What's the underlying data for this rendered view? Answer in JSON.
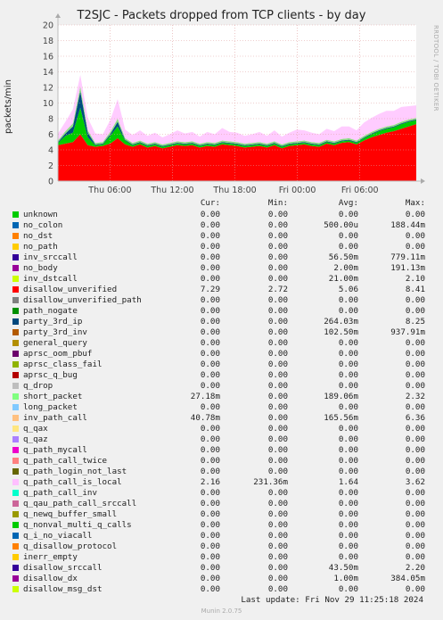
{
  "header": {
    "title": "T2SJC - Packets dropped from TCP clients - by day",
    "ylabel": "packets/min",
    "side_text": "RRDTOOL / TOBI OETIKER"
  },
  "chart_data": {
    "type": "area",
    "title": "T2SJC - Packets dropped from TCP clients - by day",
    "xlabel": "",
    "ylabel": "packets/min",
    "ylim": [
      0,
      20
    ],
    "yticks": [
      0,
      2,
      4,
      6,
      8,
      10,
      12,
      14,
      16,
      18,
      20
    ],
    "xticks": [
      "Thu 06:00",
      "Thu 12:00",
      "Thu 18:00",
      "Fri 00:00",
      "Fri 06:00"
    ],
    "x_range_hours": [
      "Thu 01:00",
      "Fri 11:25"
    ],
    "grid": true,
    "series": [
      {
        "name": "disallow_unverified",
        "color": "#ff0000",
        "values": [
          4.6,
          4.8,
          5.0,
          6.0,
          4.6,
          4.4,
          4.5,
          4.8,
          5.5,
          4.7,
          4.4,
          4.7,
          4.3,
          4.5,
          4.2,
          4.4,
          4.6,
          4.5,
          4.6,
          4.3,
          4.5,
          4.4,
          4.7,
          4.6,
          4.5,
          4.3,
          4.4,
          4.5,
          4.3,
          4.6,
          4.2,
          4.5,
          4.6,
          4.7,
          4.5,
          4.4,
          4.8,
          4.6,
          4.9,
          5.0,
          4.7,
          5.2,
          5.6,
          5.9,
          6.2,
          6.4,
          6.7,
          7.0,
          7.3
        ]
      },
      {
        "name": "q_path_call_is_local",
        "color": "#00cc00",
        "values": [
          0.3,
          1.0,
          1.2,
          3.4,
          1.0,
          0.2,
          0.2,
          1.0,
          1.5,
          0.5,
          0.2,
          0.2,
          0.2,
          0.2,
          0.2,
          0.2,
          0.2,
          0.2,
          0.2,
          0.2,
          0.2,
          0.2,
          0.2,
          0.2,
          0.2,
          0.2,
          0.2,
          0.2,
          0.2,
          0.2,
          0.2,
          0.2,
          0.2,
          0.2,
          0.2,
          0.2,
          0.2,
          0.2,
          0.2,
          0.2,
          0.2,
          0.3,
          0.4,
          0.5,
          0.5,
          0.5,
          0.6,
          0.6,
          0.5
        ]
      },
      {
        "name": "party_3rd_ip",
        "color": "#004d80",
        "values": [
          0.1,
          0.3,
          0.8,
          2.1,
          0.6,
          0.1,
          0.1,
          0.2,
          0.6,
          0.1,
          0.1,
          0.1,
          0.1,
          0.1,
          0.1,
          0.1,
          0.1,
          0.1,
          0.1,
          0.1,
          0.1,
          0.1,
          0.1,
          0.1,
          0.1,
          0.1,
          0.1,
          0.1,
          0.1,
          0.1,
          0.1,
          0.1,
          0.1,
          0.1,
          0.1,
          0.1,
          0.1,
          0.1,
          0.1,
          0.1,
          0.1,
          0.1,
          0.1,
          0.1,
          0.1,
          0.1,
          0.1,
          0.1,
          0.1
        ]
      },
      {
        "name": "short_packet",
        "color": "#8fde84",
        "values": [
          0.2,
          0.3,
          0.4,
          0.6,
          0.3,
          0.2,
          0.2,
          0.3,
          0.4,
          0.2,
          0.2,
          0.2,
          0.2,
          0.2,
          0.2,
          0.2,
          0.2,
          0.2,
          0.2,
          0.2,
          0.2,
          0.2,
          0.2,
          0.2,
          0.2,
          0.2,
          0.2,
          0.2,
          0.2,
          0.2,
          0.2,
          0.2,
          0.2,
          0.2,
          0.2,
          0.2,
          0.2,
          0.2,
          0.2,
          0.2,
          0.2,
          0.2,
          0.2,
          0.2,
          0.2,
          0.2,
          0.2,
          0.2,
          0.2
        ]
      },
      {
        "name": "inv_path_call",
        "color": "#ffccff",
        "values": [
          0.9,
          1.2,
          1.8,
          1.5,
          1.6,
          1.2,
          1.0,
          1.5,
          2.5,
          1.1,
          1.0,
          1.3,
          1.0,
          1.2,
          0.9,
          1.1,
          1.4,
          1.1,
          1.2,
          0.9,
          1.3,
          1.1,
          1.6,
          1.2,
          1.2,
          1.0,
          1.1,
          1.3,
          1.0,
          1.4,
          1.0,
          1.2,
          1.5,
          1.3,
          1.2,
          1.1,
          1.4,
          1.3,
          1.6,
          1.5,
          1.3,
          1.7,
          1.8,
          1.9,
          2.0,
          1.8,
          1.9,
          1.7,
          1.6
        ]
      }
    ]
  },
  "legend": {
    "headers": [
      "Cur:",
      "Min:",
      "Avg:",
      "Max:"
    ],
    "rows": [
      {
        "name": "unknown",
        "color": "#00cc00",
        "cur": "0.00",
        "min": "0.00",
        "avg": "0.00",
        "max": "0.00"
      },
      {
        "name": "no_colon",
        "color": "#0066b3",
        "cur": "0.00",
        "min": "0.00",
        "avg": "500.00u",
        "max": "188.44m"
      },
      {
        "name": "no_dst",
        "color": "#ff8000",
        "cur": "0.00",
        "min": "0.00",
        "avg": "0.00",
        "max": "0.00"
      },
      {
        "name": "no_path",
        "color": "#ffcc00",
        "cur": "0.00",
        "min": "0.00",
        "avg": "0.00",
        "max": "0.00"
      },
      {
        "name": "inv_srccall",
        "color": "#330099",
        "cur": "0.00",
        "min": "0.00",
        "avg": "56.50m",
        "max": "779.11m"
      },
      {
        "name": "no_body",
        "color": "#990099",
        "cur": "0.00",
        "min": "0.00",
        "avg": "2.00m",
        "max": "191.13m"
      },
      {
        "name": "inv_dstcall",
        "color": "#ccff00",
        "cur": "0.00",
        "min": "0.00",
        "avg": "21.00m",
        "max": "2.10"
      },
      {
        "name": "disallow_unverified",
        "color": "#ff0000",
        "cur": "7.29",
        "min": "2.72",
        "avg": "5.06",
        "max": "8.41"
      },
      {
        "name": "disallow_unverified_path",
        "color": "#808080",
        "cur": "0.00",
        "min": "0.00",
        "avg": "0.00",
        "max": "0.00"
      },
      {
        "name": "path_nogate",
        "color": "#008f00",
        "cur": "0.00",
        "min": "0.00",
        "avg": "0.00",
        "max": "0.00"
      },
      {
        "name": "party_3rd_ip",
        "color": "#00487d",
        "cur": "0.00",
        "min": "0.00",
        "avg": "264.03m",
        "max": "8.25"
      },
      {
        "name": "party_3rd_inv",
        "color": "#b35a00",
        "cur": "0.00",
        "min": "0.00",
        "avg": "102.50m",
        "max": "937.91m"
      },
      {
        "name": "general_query",
        "color": "#b38f00",
        "cur": "0.00",
        "min": "0.00",
        "avg": "0.00",
        "max": "0.00"
      },
      {
        "name": "aprsc_oom_pbuf",
        "color": "#6b006b",
        "cur": "0.00",
        "min": "0.00",
        "avg": "0.00",
        "max": "0.00"
      },
      {
        "name": "aprsc_class_fail",
        "color": "#8fb300",
        "cur": "0.00",
        "min": "0.00",
        "avg": "0.00",
        "max": "0.00"
      },
      {
        "name": "aprsc_q_bug",
        "color": "#b30000",
        "cur": "0.00",
        "min": "0.00",
        "avg": "0.00",
        "max": "0.00"
      },
      {
        "name": "q_drop",
        "color": "#bebebe",
        "cur": "0.00",
        "min": "0.00",
        "avg": "0.00",
        "max": "0.00"
      },
      {
        "name": "short_packet",
        "color": "#80ff80",
        "cur": "27.18m",
        "min": "0.00",
        "avg": "189.06m",
        "max": "2.32"
      },
      {
        "name": "long_packet",
        "color": "#80c9ff",
        "cur": "0.00",
        "min": "0.00",
        "avg": "0.00",
        "max": "0.00"
      },
      {
        "name": "inv_path_call",
        "color": "#ffc080",
        "cur": "40.78m",
        "min": "0.00",
        "avg": "165.56m",
        "max": "6.36"
      },
      {
        "name": "q_qax",
        "color": "#ffe680",
        "cur": "0.00",
        "min": "0.00",
        "avg": "0.00",
        "max": "0.00"
      },
      {
        "name": "q_qaz",
        "color": "#aa80ff",
        "cur": "0.00",
        "min": "0.00",
        "avg": "0.00",
        "max": "0.00"
      },
      {
        "name": "q_path_mycall",
        "color": "#ee00cc",
        "cur": "0.00",
        "min": "0.00",
        "avg": "0.00",
        "max": "0.00"
      },
      {
        "name": "q_path_call_twice",
        "color": "#ff8080",
        "cur": "0.00",
        "min": "0.00",
        "avg": "0.00",
        "max": "0.00"
      },
      {
        "name": "q_path_login_not_last",
        "color": "#666600",
        "cur": "0.00",
        "min": "0.00",
        "avg": "0.00",
        "max": "0.00"
      },
      {
        "name": "q_path_call_is_local",
        "color": "#ffbfff",
        "cur": "2.16",
        "min": "231.36m",
        "avg": "1.64",
        "max": "3.62"
      },
      {
        "name": "q_path_call_inv",
        "color": "#00ffcc",
        "cur": "0.00",
        "min": "0.00",
        "avg": "0.00",
        "max": "0.00"
      },
      {
        "name": "q_qau_path_call_srccall",
        "color": "#cc6699",
        "cur": "0.00",
        "min": "0.00",
        "avg": "0.00",
        "max": "0.00"
      },
      {
        "name": "q_newq_buffer_small",
        "color": "#999900",
        "cur": "0.00",
        "min": "0.00",
        "avg": "0.00",
        "max": "0.00"
      },
      {
        "name": "q_nonval_multi_q_calls",
        "color": "#00cc00",
        "cur": "0.00",
        "min": "0.00",
        "avg": "0.00",
        "max": "0.00"
      },
      {
        "name": "q_i_no_viacall",
        "color": "#0066b3",
        "cur": "0.00",
        "min": "0.00",
        "avg": "0.00",
        "max": "0.00"
      },
      {
        "name": "q_disallow_protocol",
        "color": "#ff8000",
        "cur": "0.00",
        "min": "0.00",
        "avg": "0.00",
        "max": "0.00"
      },
      {
        "name": "inerr_empty",
        "color": "#ffcc00",
        "cur": "0.00",
        "min": "0.00",
        "avg": "0.00",
        "max": "0.00"
      },
      {
        "name": "disallow_srccall",
        "color": "#330099",
        "cur": "0.00",
        "min": "0.00",
        "avg": "43.50m",
        "max": "2.20"
      },
      {
        "name": "disallow_dx",
        "color": "#990099",
        "cur": "0.00",
        "min": "0.00",
        "avg": "1.00m",
        "max": "384.05m"
      },
      {
        "name": "disallow_msg_dst",
        "color": "#ccff00",
        "cur": "0.00",
        "min": "0.00",
        "avg": "0.00",
        "max": "0.00"
      }
    ]
  },
  "footer": {
    "last_update": "Last update: Fri Nov 29 11:25:18 2024",
    "munin": "Munin 2.0.75"
  }
}
